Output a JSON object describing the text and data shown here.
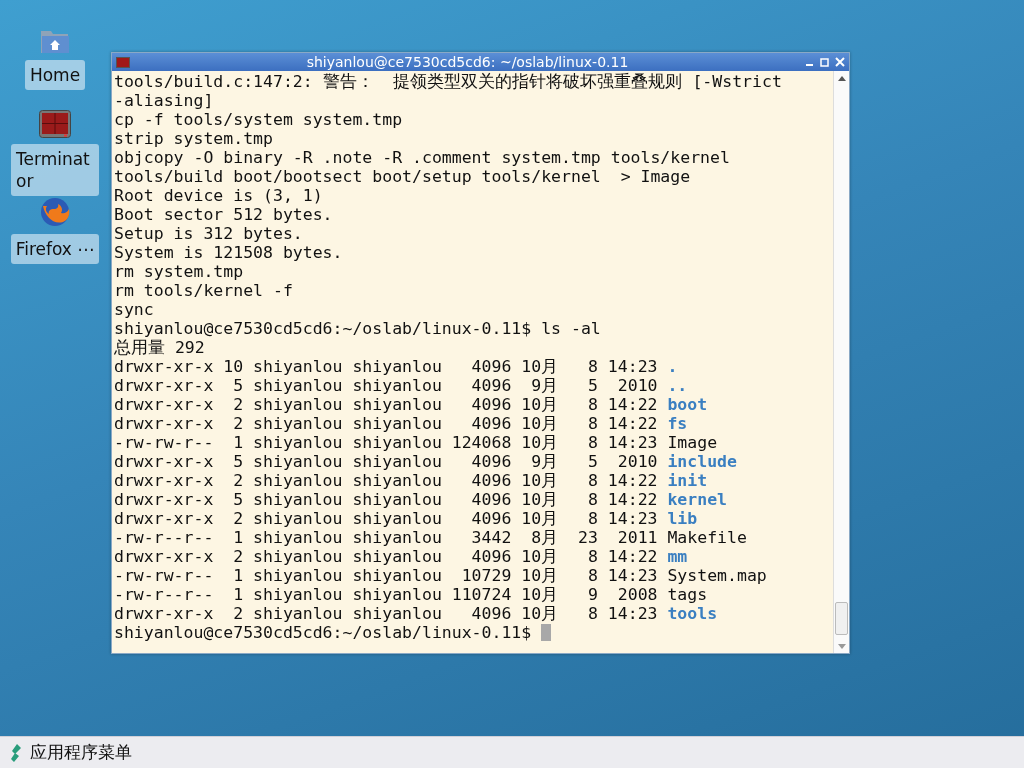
{
  "desktop_icons": [
    {
      "kind": "home",
      "label": "Home"
    },
    {
      "kind": "terminal",
      "label": "Terminator"
    },
    {
      "kind": "browser",
      "label": "Firefox ⋯"
    }
  ],
  "window": {
    "title": "shiyanlou@ce7530cd5cd6: ~/oslab/linux-0.11"
  },
  "terminal": {
    "lines": [
      {
        "text": "tools/build.c:147:2: 警告：  提领类型双关的指针将破坏强重叠规则 [-Wstrict"
      },
      {
        "text": "-aliasing]"
      },
      {
        "text": "cp -f tools/system system.tmp"
      },
      {
        "text": "strip system.tmp"
      },
      {
        "text": "objcopy -O binary -R .note -R .comment system.tmp tools/kernel"
      },
      {
        "text": "tools/build boot/bootsect boot/setup tools/kernel  > Image"
      },
      {
        "text": "Root device is (3, 1)"
      },
      {
        "text": "Boot sector 512 bytes."
      },
      {
        "text": "Setup is 312 bytes."
      },
      {
        "text": "System is 121508 bytes."
      },
      {
        "text": "rm system.tmp"
      },
      {
        "text": "rm tools/kernel -f"
      },
      {
        "text": "sync"
      },
      {
        "text": "shiyanlou@ce7530cd5cd6:~/oslab/linux-0.11$ ls -al"
      },
      {
        "text": "总用量 292"
      },
      {
        "text": "drwxr-xr-x 10 shiyanlou shiyanlou   4096 10月   8 14:23 ",
        "name": ".",
        "kind": "dir"
      },
      {
        "text": "drwxr-xr-x  5 shiyanlou shiyanlou   4096  9月   5  2010 ",
        "name": "..",
        "kind": "dir"
      },
      {
        "text": "drwxr-xr-x  2 shiyanlou shiyanlou   4096 10月   8 14:22 ",
        "name": "boot",
        "kind": "dir"
      },
      {
        "text": "drwxr-xr-x  2 shiyanlou shiyanlou   4096 10月   8 14:22 ",
        "name": "fs",
        "kind": "dir"
      },
      {
        "text": "-rw-rw-r--  1 shiyanlou shiyanlou 124068 10月   8 14:23 ",
        "name": "Image",
        "kind": "file"
      },
      {
        "text": "drwxr-xr-x  5 shiyanlou shiyanlou   4096  9月   5  2010 ",
        "name": "include",
        "kind": "dir"
      },
      {
        "text": "drwxr-xr-x  2 shiyanlou shiyanlou   4096 10月   8 14:22 ",
        "name": "init",
        "kind": "dir"
      },
      {
        "text": "drwxr-xr-x  5 shiyanlou shiyanlou   4096 10月   8 14:22 ",
        "name": "kernel",
        "kind": "dir"
      },
      {
        "text": "drwxr-xr-x  2 shiyanlou shiyanlou   4096 10月   8 14:23 ",
        "name": "lib",
        "kind": "dir"
      },
      {
        "text": "-rw-r--r--  1 shiyanlou shiyanlou   3442  8月  23  2011 ",
        "name": "Makefile",
        "kind": "file"
      },
      {
        "text": "drwxr-xr-x  2 shiyanlou shiyanlou   4096 10月   8 14:22 ",
        "name": "mm",
        "kind": "dir"
      },
      {
        "text": "-rw-rw-r--  1 shiyanlou shiyanlou  10729 10月   8 14:23 ",
        "name": "System.map",
        "kind": "file"
      },
      {
        "text": "-rw-r--r--  1 shiyanlou shiyanlou 110724 10月   9  2008 ",
        "name": "tags",
        "kind": "file"
      },
      {
        "text": "drwxr-xr-x  2 shiyanlou shiyanlou   4096 10月   8 14:23 ",
        "name": "tools",
        "kind": "dir"
      }
    ],
    "prompt": "shiyanlou@ce7530cd5cd6:~/oslab/linux-0.11$ "
  },
  "taskbar": {
    "menu_label": "应用程序菜单"
  }
}
